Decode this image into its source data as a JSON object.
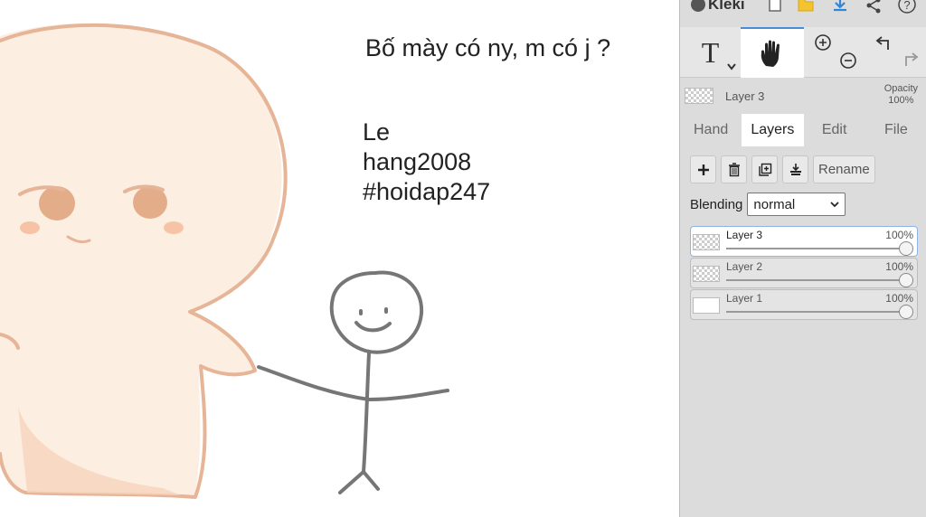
{
  "canvas": {
    "caption": "Bố mày có ny, m có j ?",
    "signature_lines": [
      "Le",
      "hang2008",
      "#hoidap247"
    ]
  },
  "app": {
    "name": "Kleki"
  },
  "tools": {
    "text_glyph": "T",
    "active_tool": "hand",
    "zoom_in_icon": "zoom-in-icon",
    "zoom_out_icon": "zoom-out-icon"
  },
  "active_layer": {
    "name": "Layer 3",
    "opacity_label": "Opacity",
    "opacity_value": "100%"
  },
  "tabs": [
    {
      "label": "Hand",
      "active": false
    },
    {
      "label": "Layers",
      "active": true
    },
    {
      "label": "Edit",
      "active": false
    },
    {
      "label": "File",
      "active": false
    }
  ],
  "layers_panel": {
    "rename_label": "Rename",
    "blending_label": "Blending",
    "blending_value": "normal",
    "layers": [
      {
        "name": "Layer 3",
        "opacity": "100%",
        "opacity_fraction": 1.0,
        "selected": true,
        "thumb": "transparent"
      },
      {
        "name": "Layer 2",
        "opacity": "100%",
        "opacity_fraction": 1.0,
        "selected": false,
        "thumb": "transparent"
      },
      {
        "name": "Layer 1",
        "opacity": "100%",
        "opacity_fraction": 1.0,
        "selected": false,
        "thumb": "white"
      }
    ]
  },
  "colors": {
    "accent": "#4a8bd8",
    "save_icon": "#f4c430",
    "download_icon": "#2f86d6"
  }
}
